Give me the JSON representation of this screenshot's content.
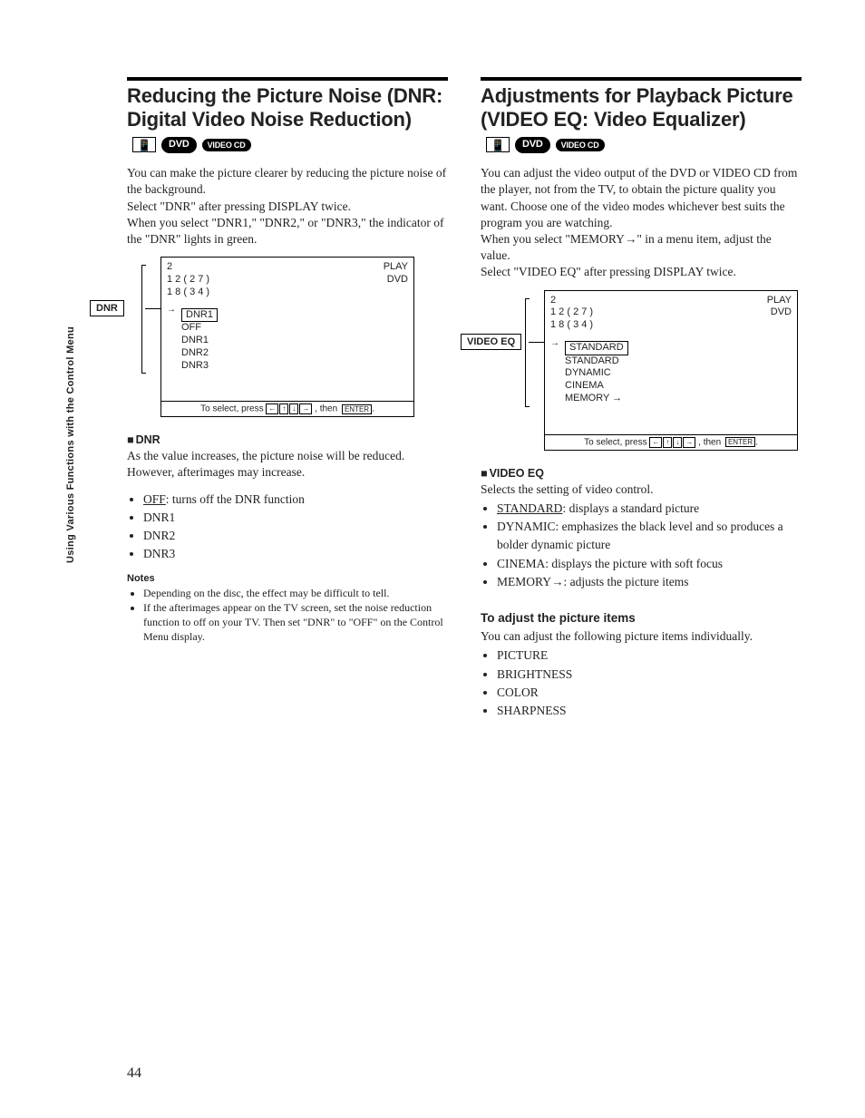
{
  "side_label": "Using Various Functions with the Control Menu",
  "page_number": "44",
  "badges": {
    "dvd": "DVD",
    "vcd": "VIDEO CD"
  },
  "left": {
    "title": "Reducing the Picture Noise (DNR: Digital Video Noise Reduction)",
    "intro": "You can make the picture clearer by reducing the picture noise of the background.\nSelect \"DNR\" after pressing DISPLAY twice.\nWhen you select \"DNR1,\" \"DNR2,\" or \"DNR3,\" the indicator of the \"DNR\" lights in green.",
    "osd": {
      "label": "DNR",
      "nums": "2\n1 2 ( 2 7 )\n1 8 ( 3 4 )",
      "status_play": "PLAY",
      "status_media": "DVD",
      "items": [
        "DNR1",
        "OFF",
        "DNR1",
        "DNR2",
        "DNR3"
      ],
      "selected_index": 0,
      "footer_pre": "To select, press ",
      "footer_post": ", then ",
      "footer_enter": "ENTER"
    },
    "sub_title": "DNR",
    "sub_desc": "As the value increases, the picture noise will be reduced. However, afterimages may increase.",
    "bullets": [
      {
        "label": "OFF",
        "desc": ": turns off the DNR function",
        "underline": true
      },
      {
        "label": "DNR1",
        "desc": "",
        "underline": false
      },
      {
        "label": "DNR2",
        "desc": "",
        "underline": false
      },
      {
        "label": "DNR3",
        "desc": "",
        "underline": false
      }
    ],
    "notes_head": "Notes",
    "notes": [
      "Depending on the disc, the effect may be difficult to tell.",
      "If the afterimages appear on the TV screen, set the noise reduction function to off on your TV. Then set \"DNR\" to \"OFF\" on the Control Menu display."
    ]
  },
  "right": {
    "title": "Adjustments for Playback Picture (VIDEO EQ: Video Equalizer)",
    "intro": "You can adjust the video output of the DVD or VIDEO CD from the player, not from the TV, to obtain the picture quality you want. Choose one of the video modes whichever best suits the program you are watching.\nWhen you select \"MEMORY→\" in a menu item, adjust the value.\nSelect \"VIDEO EQ\" after pressing DISPLAY twice.",
    "osd": {
      "label": "VIDEO EQ",
      "nums": "2\n1 2 ( 2 7 )\n1 8 ( 3 4 )",
      "status_play": "PLAY",
      "status_media": "DVD",
      "items": [
        "STANDARD",
        "STANDARD",
        "DYNAMIC",
        "CINEMA",
        "MEMORY →"
      ],
      "selected_index": 0,
      "footer_pre": "To select, press ",
      "footer_post": ", then ",
      "footer_enter": "ENTER"
    },
    "sub_title": "VIDEO EQ",
    "sub_desc": "Selects the setting of video control.",
    "bullets": [
      {
        "label": "STANDARD",
        "desc": ": displays a standard picture",
        "underline": true
      },
      {
        "label": "DYNAMIC",
        "desc": ": emphasizes the black level and so produces a bolder dynamic picture",
        "underline": false
      },
      {
        "label": "CINEMA",
        "desc": ": displays the picture with soft focus",
        "underline": false
      },
      {
        "label": "MEMORY→",
        "desc": ": adjusts the picture items",
        "underline": false
      }
    ],
    "adjust_head": "To adjust the picture items",
    "adjust_desc": "You can adjust the following picture items individually.",
    "adjust_items": [
      "PICTURE",
      "BRIGHTNESS",
      "COLOR",
      "SHARPNESS"
    ]
  }
}
